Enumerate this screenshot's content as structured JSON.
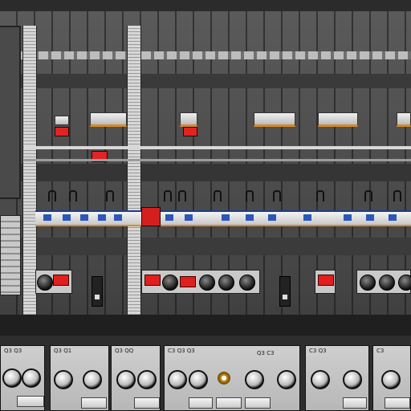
{
  "app": {
    "title": ""
  },
  "colors": {
    "panel_dark": "#3a3a3a",
    "panel_mid": "#555555",
    "indicator_red": "#e02424",
    "strip_blue": "#2c56b8",
    "strip_orange": "#d98a2a",
    "module_face": "#c7c7c7"
  },
  "icons": [
    "breaker-switch-icon",
    "indicator-lamp-icon",
    "rotary-knob-icon",
    "toggle-switch-icon",
    "fader-icon"
  ],
  "bottom_mixer": {
    "modules": [
      {
        "label": "Q3 Q3"
      },
      {
        "label": "Q3 Q1"
      },
      {
        "label": "Q3  QQ"
      },
      {
        "label": "C3 Q3  Q3"
      },
      {
        "label": "Q3 C3"
      },
      {
        "label": "C3 Q3"
      },
      {
        "label": "C3"
      }
    ]
  }
}
